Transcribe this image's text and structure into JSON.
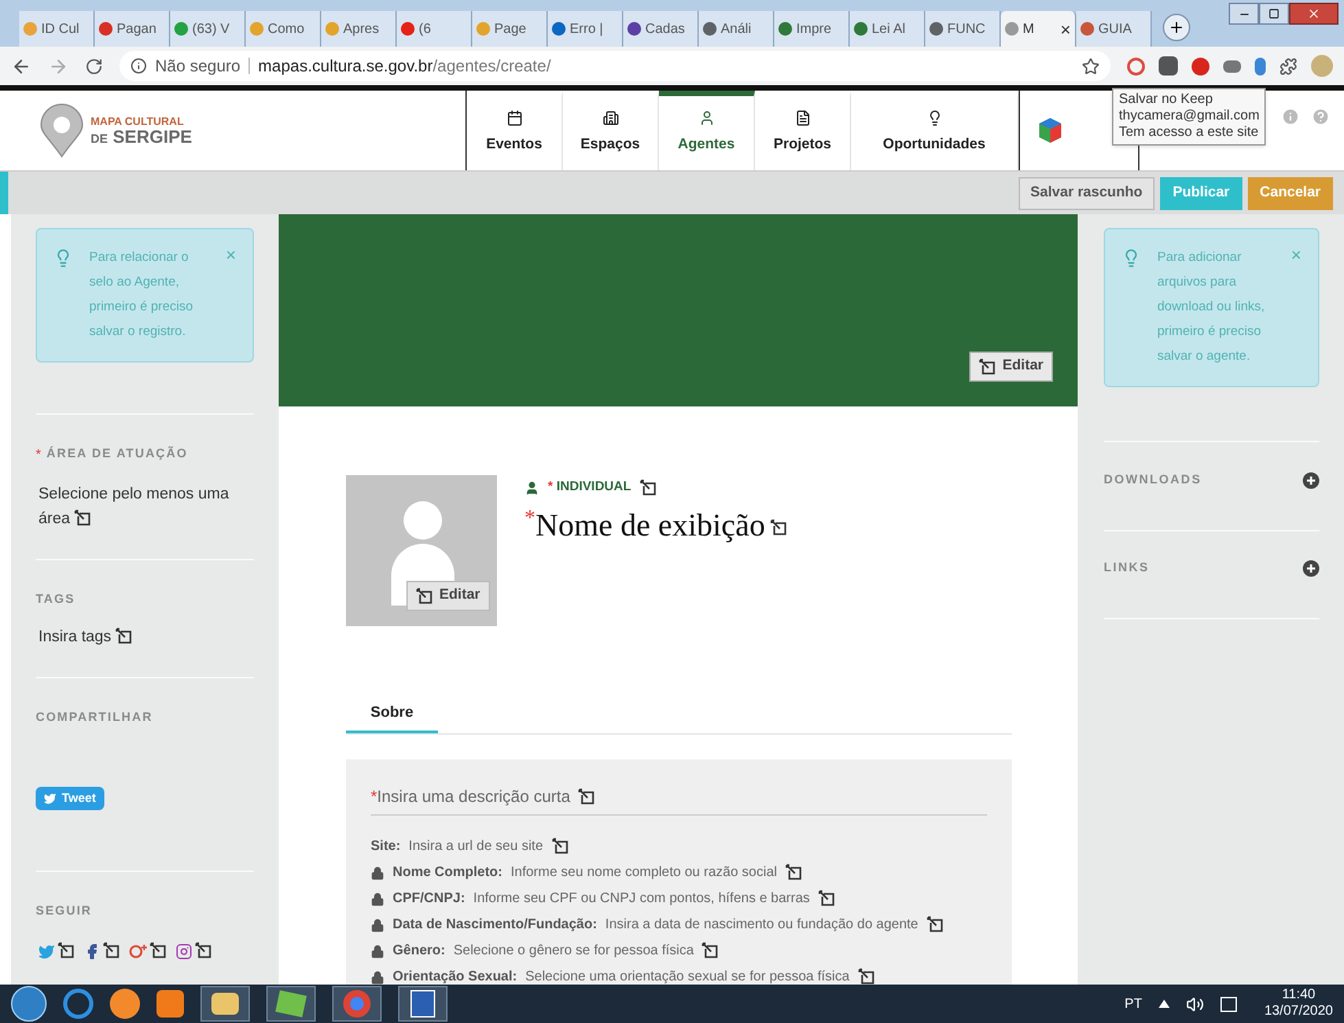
{
  "browser": {
    "tabs": [
      {
        "title": "ID Cul",
        "color": "#e8a33c",
        "selected": false
      },
      {
        "title": "Pagan",
        "color": "#d93025",
        "selected": false
      },
      {
        "title": "(63) V",
        "color": "#25a244",
        "selected": false
      },
      {
        "title": "Como",
        "color": "#e2a42b",
        "selected": false
      },
      {
        "title": "Apres",
        "color": "#e2a42b",
        "selected": false
      },
      {
        "title": "(6",
        "color": "#e62117",
        "selected": false
      },
      {
        "title": "Page",
        "color": "#e2a42b",
        "selected": false
      },
      {
        "title": "Erro |",
        "color": "#0d66c2",
        "selected": false
      },
      {
        "title": "Cadas",
        "color": "#5b3fa6",
        "selected": false
      },
      {
        "title": "Análi",
        "color": "#5f6368",
        "selected": false
      },
      {
        "title": "Impre",
        "color": "#2f7a3a",
        "selected": false
      },
      {
        "title": "Lei Al",
        "color": "#2f7a3a",
        "selected": false
      },
      {
        "title": "FUNC",
        "color": "#5f6368",
        "selected": false
      },
      {
        "title": "M",
        "color": "#9a9a9a",
        "selected": true
      },
      {
        "title": "GUIA",
        "color": "#c9563c",
        "selected": false
      }
    ],
    "close_mark": "×",
    "address": {
      "security": "Não seguro",
      "host": "mapas.cultura.se.gov.br",
      "path": "/agentes/create/"
    },
    "tooltip": [
      "Salvar no Keep",
      "thycamera@gmail.com",
      "Tem acesso a este site"
    ]
  },
  "header": {
    "logo": {
      "line1": "MAPA CULTURAL",
      "prefix": "DE",
      "line2": "SERGIPE"
    },
    "nav": [
      {
        "label": "Eventos",
        "kind": "calendar",
        "selected": false
      },
      {
        "label": "Espaços",
        "kind": "building",
        "selected": false
      },
      {
        "label": "Agentes",
        "kind": "person",
        "selected": true
      },
      {
        "label": "Projetos",
        "kind": "document",
        "selected": false
      },
      {
        "label": "Oportunidades",
        "kind": "bulb",
        "selected": false
      }
    ]
  },
  "toolbar": {
    "buttons": [
      {
        "label": "Salvar rascunho",
        "kind": "draft"
      },
      {
        "label": "Publicar",
        "kind": "publish"
      },
      {
        "label": "Cancelar",
        "kind": "cancel"
      }
    ]
  },
  "left_sidebar": {
    "notice": {
      "text": "Para relacionar o selo ao Agente, primeiro é preciso salvar o registro.",
      "close": "×"
    },
    "sections": [
      {
        "title": "ÁREA DE ATUAÇÃO",
        "required_mark": "*",
        "value": "Selecione pelo menos uma área",
        "kind": "editable"
      },
      {
        "title": "TAGS",
        "value": "Insira tags",
        "kind": "editable"
      },
      {
        "title": "COMPARTILHAR",
        "kind": "share",
        "button": "Tweet"
      },
      {
        "title": "SEGUIR",
        "kind": "follow",
        "networks": [
          {
            "kind": "twitter"
          },
          {
            "kind": "facebook"
          },
          {
            "kind": "googleplus"
          },
          {
            "kind": "instagram"
          }
        ]
      }
    ]
  },
  "cover": {
    "edit": "Editar"
  },
  "profile": {
    "avatar_edit": "Editar",
    "type_mark": "*",
    "type": "INDIVIDUAL",
    "name_mark": "*",
    "name": "Nome de exibição",
    "tabs": [
      {
        "label": "Sobre",
        "selected": true
      }
    ],
    "description_mark": "*",
    "description_placeholder": "Insira uma descrição curta",
    "fields": [
      {
        "label": "Site:",
        "placeholder": "Insira a url de seu site",
        "locked": false
      },
      {
        "label": "Nome Completo:",
        "placeholder": "Informe seu nome completo ou razão social",
        "locked": true
      },
      {
        "label": "CPF/CNPJ:",
        "placeholder": "Informe seu CPF ou CNPJ com pontos, hífens e barras",
        "locked": true
      },
      {
        "label": "Data de Nascimento/Fundação:",
        "placeholder": "Insira a data de nascimento ou fundação do agente",
        "locked": true
      },
      {
        "label": "Gênero:",
        "placeholder": "Selecione o gênero se for pessoa física",
        "locked": true
      },
      {
        "label": "Orientação Sexual:",
        "placeholder": "Selecione uma orientação sexual se for pessoa física",
        "locked": true
      }
    ]
  },
  "right_sidebar": {
    "notice": {
      "text": "Para adicionar arquivos para download ou links, primeiro é preciso salvar o agente.",
      "close": "×"
    },
    "sections": [
      "DOWNLOADS",
      "LINKS"
    ]
  },
  "taskbar": {
    "language": "PT",
    "time": "11:40",
    "date": "13/07/2020"
  }
}
